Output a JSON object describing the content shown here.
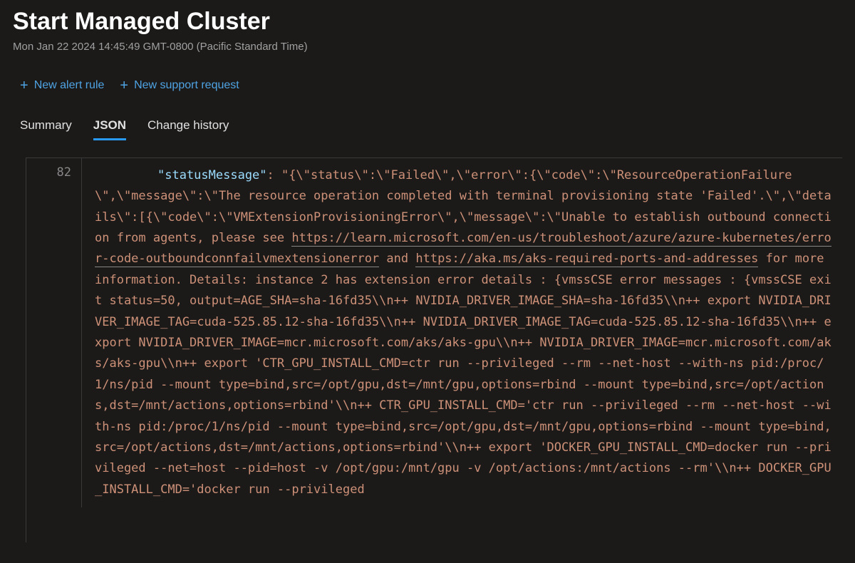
{
  "header": {
    "title": "Start Managed Cluster",
    "timestamp": "Mon Jan 22 2024 14:45:49 GMT-0800 (Pacific Standard Time)"
  },
  "actions": {
    "new_alert_rule": "New alert rule",
    "new_support_request": "New support request"
  },
  "tabs": {
    "summary": "Summary",
    "json": "JSON",
    "change_history": "Change history"
  },
  "json_view": {
    "line_number": "82",
    "key": "\"statusMessage\"",
    "colon": ": ",
    "seg1": "\"{\\\"status\\\":\\\"Failed\\\",\\\"error\\\":{\\\"code\\\":\\\"ResourceOperationFailure\\\",\\\"message\\\":\\\"The resource operation completed with terminal provisioning state 'Failed'.\\\",\\\"details\\\":[{\\\"code\\\":\\\"VMExtensionProvisioningError\\\",\\\"message\\\":\\\"Unable to establish outbound connection from agents, please see ",
    "link1": "https://learn.microsoft.com/en-us/troubleshoot/azure/azure-kubernetes/error-code-outboundconnfailvmextensionerror",
    "seg2": " and ",
    "link2": "https://aka.ms/aks-required-ports-and-addresses",
    "seg3": " for more information. Details: instance 2 has extension error details : {vmssCSE error messages : {vmssCSE exit status=50, output=AGE_SHA=sha-16fd35\\\\n++ NVIDIA_DRIVER_IMAGE_SHA=sha-16fd35\\\\n++ export NVIDIA_DRIVER_IMAGE_TAG=cuda-525.85.12-sha-16fd35\\\\n++ NVIDIA_DRIVER_IMAGE_TAG=cuda-525.85.12-sha-16fd35\\\\n++ export NVIDIA_DRIVER_IMAGE=mcr.microsoft.com/aks/aks-gpu\\\\n++ NVIDIA_DRIVER_IMAGE=mcr.microsoft.com/aks/aks-gpu\\\\n++ export 'CTR_GPU_INSTALL_CMD=ctr run --privileged --rm --net-host --with-ns pid:/proc/1/ns/pid --mount type=bind,src=/opt/gpu,dst=/mnt/gpu,options=rbind --mount type=bind,src=/opt/actions,dst=/mnt/actions,options=rbind'\\\\n++ CTR_GPU_INSTALL_CMD='ctr run --privileged --rm --net-host --with-ns pid:/proc/1/ns/pid --mount type=bind,src=/opt/gpu,dst=/mnt/gpu,options=rbind --mount type=bind,src=/opt/actions,dst=/mnt/actions,options=rbind'\\\\n++ export 'DOCKER_GPU_INSTALL_CMD=docker run --privileged --net=host --pid=host -v /opt/gpu:/mnt/gpu -v /opt/actions:/mnt/actions --rm'\\\\n++ DOCKER_GPU_INSTALL_CMD='docker run --privileged"
  }
}
